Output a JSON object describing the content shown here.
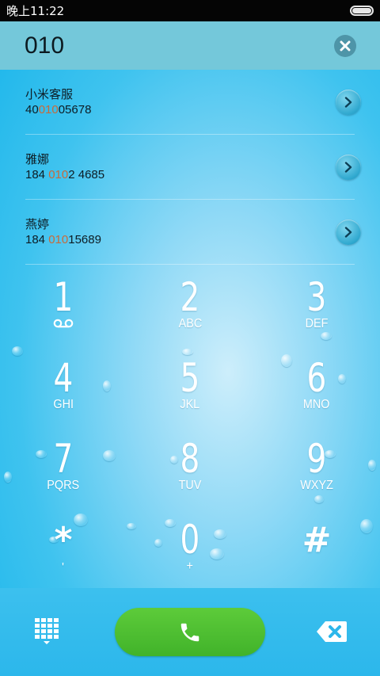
{
  "status_bar": {
    "time": "晚上11:22"
  },
  "dialer": {
    "dialed_number": "010"
  },
  "contacts": [
    {
      "name": "小米客服",
      "number_pre": "40",
      "number_match": "010",
      "number_post": "05678"
    },
    {
      "name": "雅娜",
      "number_pre": "184 ",
      "number_match": "010",
      "number_post": "2 4685"
    },
    {
      "name": "燕婷",
      "number_pre": "184 ",
      "number_match": "010",
      "number_post": "15689"
    }
  ],
  "keypad": [
    {
      "digit": "1",
      "letters": ""
    },
    {
      "digit": "2",
      "letters": "ABC"
    },
    {
      "digit": "3",
      "letters": "DEF"
    },
    {
      "digit": "4",
      "letters": "GHI"
    },
    {
      "digit": "5",
      "letters": "JKL"
    },
    {
      "digit": "6",
      "letters": "MNO"
    },
    {
      "digit": "7",
      "letters": "PQRS"
    },
    {
      "digit": "8",
      "letters": "TUV"
    },
    {
      "digit": "9",
      "letters": "WXYZ"
    },
    {
      "digit": "*",
      "letters": "'"
    },
    {
      "digit": "0",
      "letters": "+"
    },
    {
      "digit": "#",
      "letters": ""
    }
  ],
  "icons": {
    "clear": "clear-icon",
    "chevron": "chevron-right-icon",
    "voicemail": "voicemail-icon",
    "dialpad": "dialpad-icon",
    "call": "phone-icon",
    "backspace": "backspace-icon"
  },
  "colors": {
    "input_bar": "#74c8da",
    "highlight": "#c86a3a",
    "call_button": "#4cbf30",
    "status_bar": "#050505"
  }
}
